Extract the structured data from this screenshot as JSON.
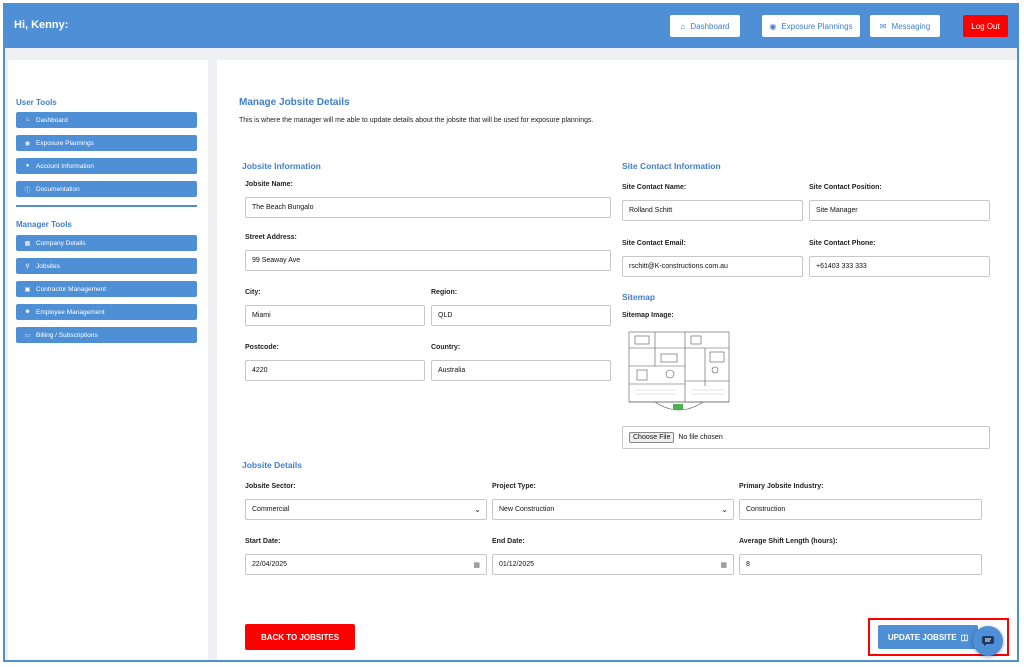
{
  "header": {
    "greeting": "Hi, Kenny:",
    "nav": [
      {
        "label": "Dashboard",
        "icon": "home-icon"
      },
      {
        "label": "Exposure Plannings",
        "icon": "helmet-icon"
      },
      {
        "label": "Messaging",
        "icon": "envelope-icon"
      }
    ],
    "logout_label": "Log Out"
  },
  "sidebar": {
    "user_tools_heading": "User Tools",
    "user_tools": [
      {
        "label": "Dashboard",
        "icon": "home-icon"
      },
      {
        "label": "Exposure Plannings",
        "icon": "helmet-icon"
      },
      {
        "label": "Account Information",
        "icon": "user-icon"
      },
      {
        "label": "Documentation",
        "icon": "info-icon"
      }
    ],
    "manager_tools_heading": "Manager Tools",
    "manager_tools": [
      {
        "label": "Company Details",
        "icon": "building-icon"
      },
      {
        "label": "Jobsites",
        "icon": "map-pin-icon"
      },
      {
        "label": "Contractor Management",
        "icon": "truck-icon"
      },
      {
        "label": "Employee Management",
        "icon": "users-icon"
      },
      {
        "label": "Billing / Subscriptions",
        "icon": "credit-card-icon"
      }
    ]
  },
  "page": {
    "title": "Manage Jobsite Details",
    "description": "This is where the manager will me able to update details about the jobsite that will be used for exposure plannings."
  },
  "jobsite_info": {
    "heading": "Jobsite Information",
    "name_label": "Jobsite Name:",
    "name_value": "The Beach Bungalo",
    "street_label": "Street Address:",
    "street_value": "99 Seaway Ave",
    "city_label": "City:",
    "city_value": "Miami",
    "region_label": "Region:",
    "region_value": "QLD",
    "postcode_label": "Postcode:",
    "postcode_value": "4220",
    "country_label": "Country:",
    "country_value": "Australia"
  },
  "site_contact": {
    "heading": "Site Contact Information",
    "name_label": "Site Contact Name:",
    "name_value": "Rolland Schitt",
    "position_label": "Site Contact Position:",
    "position_value": "Site Manager",
    "email_label": "Site Contact Email:",
    "email_value": "rschitt@K-constructions.com.au",
    "phone_label": "Site Contact Phone:",
    "phone_value": "+61403 333 333"
  },
  "sitemap": {
    "heading": "Sitemap",
    "image_label": "Sitemap Image:",
    "choose_file_label": "Choose File",
    "no_file_text": "No file chosen"
  },
  "jobsite_details": {
    "heading": "Jobsite Details",
    "sector_label": "Jobsite Sector:",
    "sector_value": "Commercial",
    "project_type_label": "Project Type:",
    "project_type_value": "New Construction",
    "industry_label": "Primary Jobsite Industry:",
    "industry_value": "Construction",
    "start_label": "Start Date:",
    "start_value": "22/04/2025",
    "end_label": "End Date:",
    "end_value": "01/12/2025",
    "shift_label": "Average Shift Length (hours):",
    "shift_value": "8"
  },
  "actions": {
    "back_label": "BACK TO JOBSITES",
    "update_label": "UPDATE JOBSITE"
  },
  "colors": {
    "primary": "#4f8fd6",
    "danger": "#ff0000",
    "background": "#eef0f4"
  }
}
